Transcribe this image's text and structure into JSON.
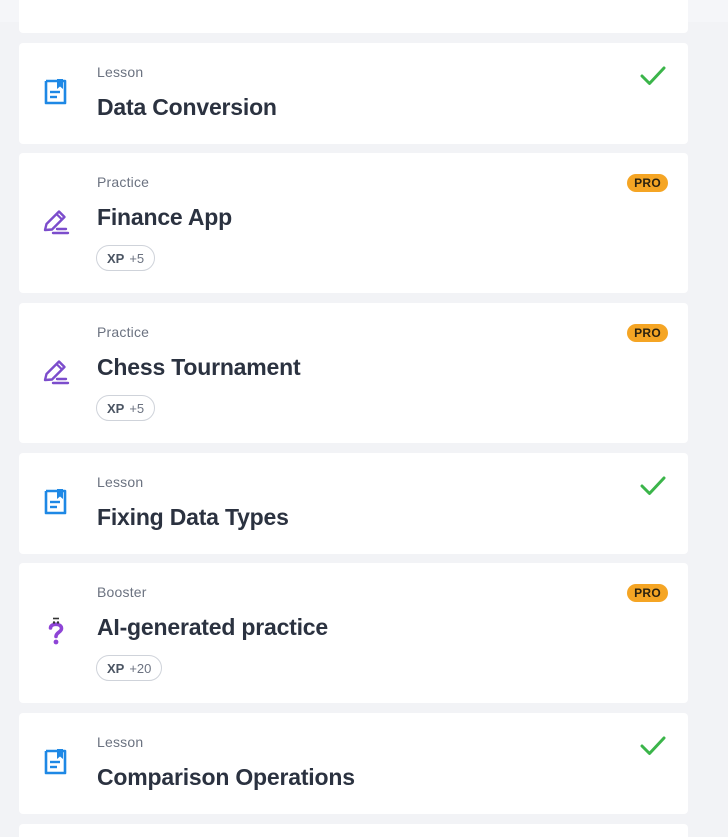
{
  "colors": {
    "lesson_icon": "#1e88e5",
    "practice_icon": "#7c4dcc",
    "booster_icon": "#8e44d6",
    "check": "#3bb54a",
    "pro_badge": "#f5a524"
  },
  "items": [
    {
      "kind": "lesson",
      "category": "Lesson",
      "title": "Data Conversion",
      "completed": true,
      "icon": "lesson-document-icon"
    },
    {
      "kind": "practice",
      "category": "Practice",
      "title": "Finance App",
      "badge": "PRO",
      "xp_label": "XP",
      "xp_value": "+5",
      "icon": "pencil-icon"
    },
    {
      "kind": "practice",
      "category": "Practice",
      "title": "Chess Tournament",
      "badge": "PRO",
      "xp_label": "XP",
      "xp_value": "+5",
      "icon": "pencil-icon"
    },
    {
      "kind": "lesson",
      "category": "Lesson",
      "title": "Fixing Data Types",
      "completed": true,
      "icon": "lesson-document-icon"
    },
    {
      "kind": "practice",
      "category": "Booster",
      "title": "AI-generated practice",
      "badge": "PRO",
      "xp_label": "XP",
      "xp_value": "+20",
      "icon": "question-sparkle-icon"
    },
    {
      "kind": "lesson",
      "category": "Lesson",
      "title": "Comparison Operations",
      "completed": true,
      "icon": "lesson-document-icon"
    }
  ]
}
